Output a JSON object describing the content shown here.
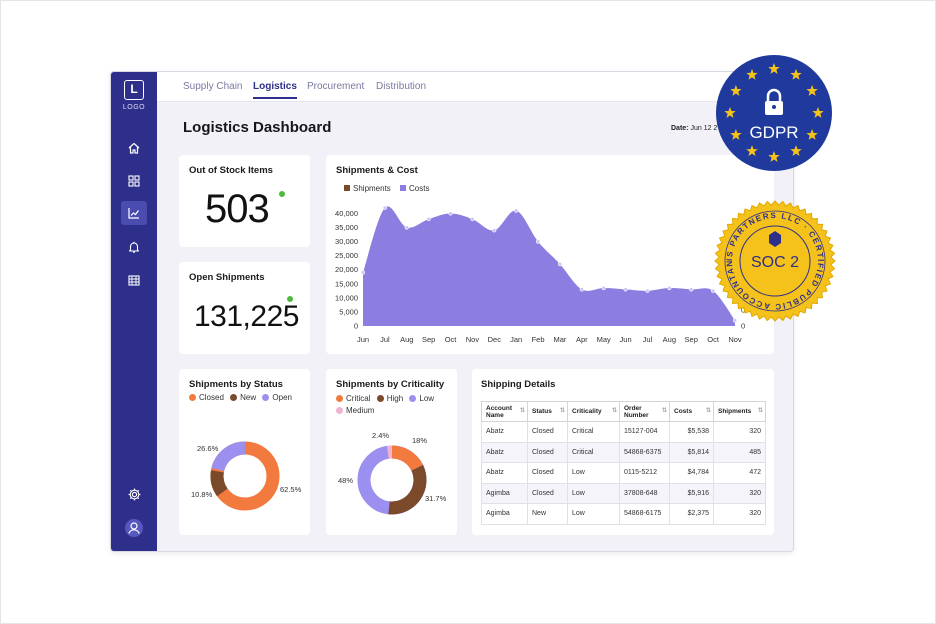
{
  "logo": {
    "letter": "L",
    "text": "LOGO"
  },
  "tabs": [
    {
      "label": "Supply Chain"
    },
    {
      "label": "Logistics"
    },
    {
      "label": "Procurement"
    },
    {
      "label": "Distribution"
    }
  ],
  "page": {
    "title": "Logistics Dashboard",
    "date_label": "Date:",
    "date_value": "Jun 12 2"
  },
  "kpis": {
    "out_of_stock": {
      "title": "Out of Stock Items",
      "value": "503"
    },
    "open_shipments": {
      "title": "Open Shipments",
      "value": "131,225"
    }
  },
  "shipments_cost": {
    "title": "Shipments & Cost",
    "legend": [
      {
        "label": "Shipments",
        "color": "#7a4a2a"
      },
      {
        "label": "Costs",
        "color": "#8b7ee0"
      }
    ]
  },
  "status": {
    "title": "Shipments by Status",
    "legend": [
      {
        "label": "Closed",
        "color": "#f27a3f"
      },
      {
        "label": "New",
        "color": "#7a4a2a"
      },
      {
        "label": "Open",
        "color": "#9b8ff0"
      }
    ],
    "labels": {
      "open": "26.6%",
      "new": "10.8%",
      "closed": "62.5%"
    }
  },
  "criticality": {
    "title": "Shipments by Criticality",
    "legend": [
      {
        "label": "Critical",
        "color": "#f27a3f"
      },
      {
        "label": "High",
        "color": "#7a4a2a"
      },
      {
        "label": "Low",
        "color": "#9b8ff0"
      },
      {
        "label": "Medium",
        "color": "#f2b3d3"
      }
    ],
    "labels": {
      "medium": "2.4%",
      "critical": "18%",
      "low": "48%",
      "high": "31.7%"
    }
  },
  "table": {
    "title": "Shipping Details",
    "headers": [
      "Account Name",
      "Status",
      "Criticality",
      "Order Number",
      "Costs",
      "Shipments"
    ],
    "rows": [
      [
        "Abatz",
        "Closed",
        "Critical",
        "15127-004",
        "$5,538",
        "320"
      ],
      [
        "Abatz",
        "Closed",
        "Critical",
        "54868-6375",
        "$5,814",
        "485"
      ],
      [
        "Abatz",
        "Closed",
        "Low",
        "0115-5212",
        "$4,784",
        "472"
      ],
      [
        "Agimba",
        "Closed",
        "Low",
        "37808-648",
        "$5,916",
        "320"
      ],
      [
        "Agimba",
        "New",
        "Low",
        "54868-6175",
        "$2,375",
        "320"
      ]
    ]
  },
  "badges": {
    "gdpr": {
      "text": "GDPR",
      "color": "#1f3a9c"
    },
    "soc2": {
      "ring_text": "IS PARTNERS LLC · CERTIFIED PUBLIC ACCOUNTANTS",
      "text": "SOC 2",
      "color": "#f5c21b"
    }
  },
  "icons": [
    "home-icon",
    "grid-icon",
    "chart-line-icon",
    "bell-icon",
    "calendar-icon",
    "settings-icon",
    "user-icon"
  ],
  "chart_data": {
    "type": "area",
    "title": "Shipments & Cost",
    "x": [
      "Jun",
      "Jul",
      "Aug",
      "Sep",
      "Oct",
      "Nov",
      "Dec",
      "Jan",
      "Feb",
      "Mar",
      "Apr",
      "May",
      "Jun",
      "Jul",
      "Aug",
      "Sep",
      "Oct",
      "Nov"
    ],
    "series": [
      {
        "name": "Costs",
        "values": [
          19000,
          42000,
          35000,
          38000,
          40000,
          38000,
          34000,
          41000,
          30000,
          22000,
          13000,
          13500,
          13000,
          12500,
          13500,
          13000,
          12500,
          2000
        ]
      }
    ],
    "yticks": [
      0,
      5000,
      10000,
      15000,
      20000,
      25000,
      30000,
      35000,
      40000
    ],
    "ytick_labels": [
      "0",
      "5,000",
      "10,000",
      "15,000",
      "20,000",
      "25,000",
      "30,000",
      "35,000",
      "40,000"
    ],
    "ylim": [
      0,
      43000
    ],
    "right_axis_labels": [
      "0",
      "0"
    ],
    "grid": false,
    "legend": "top-left"
  }
}
